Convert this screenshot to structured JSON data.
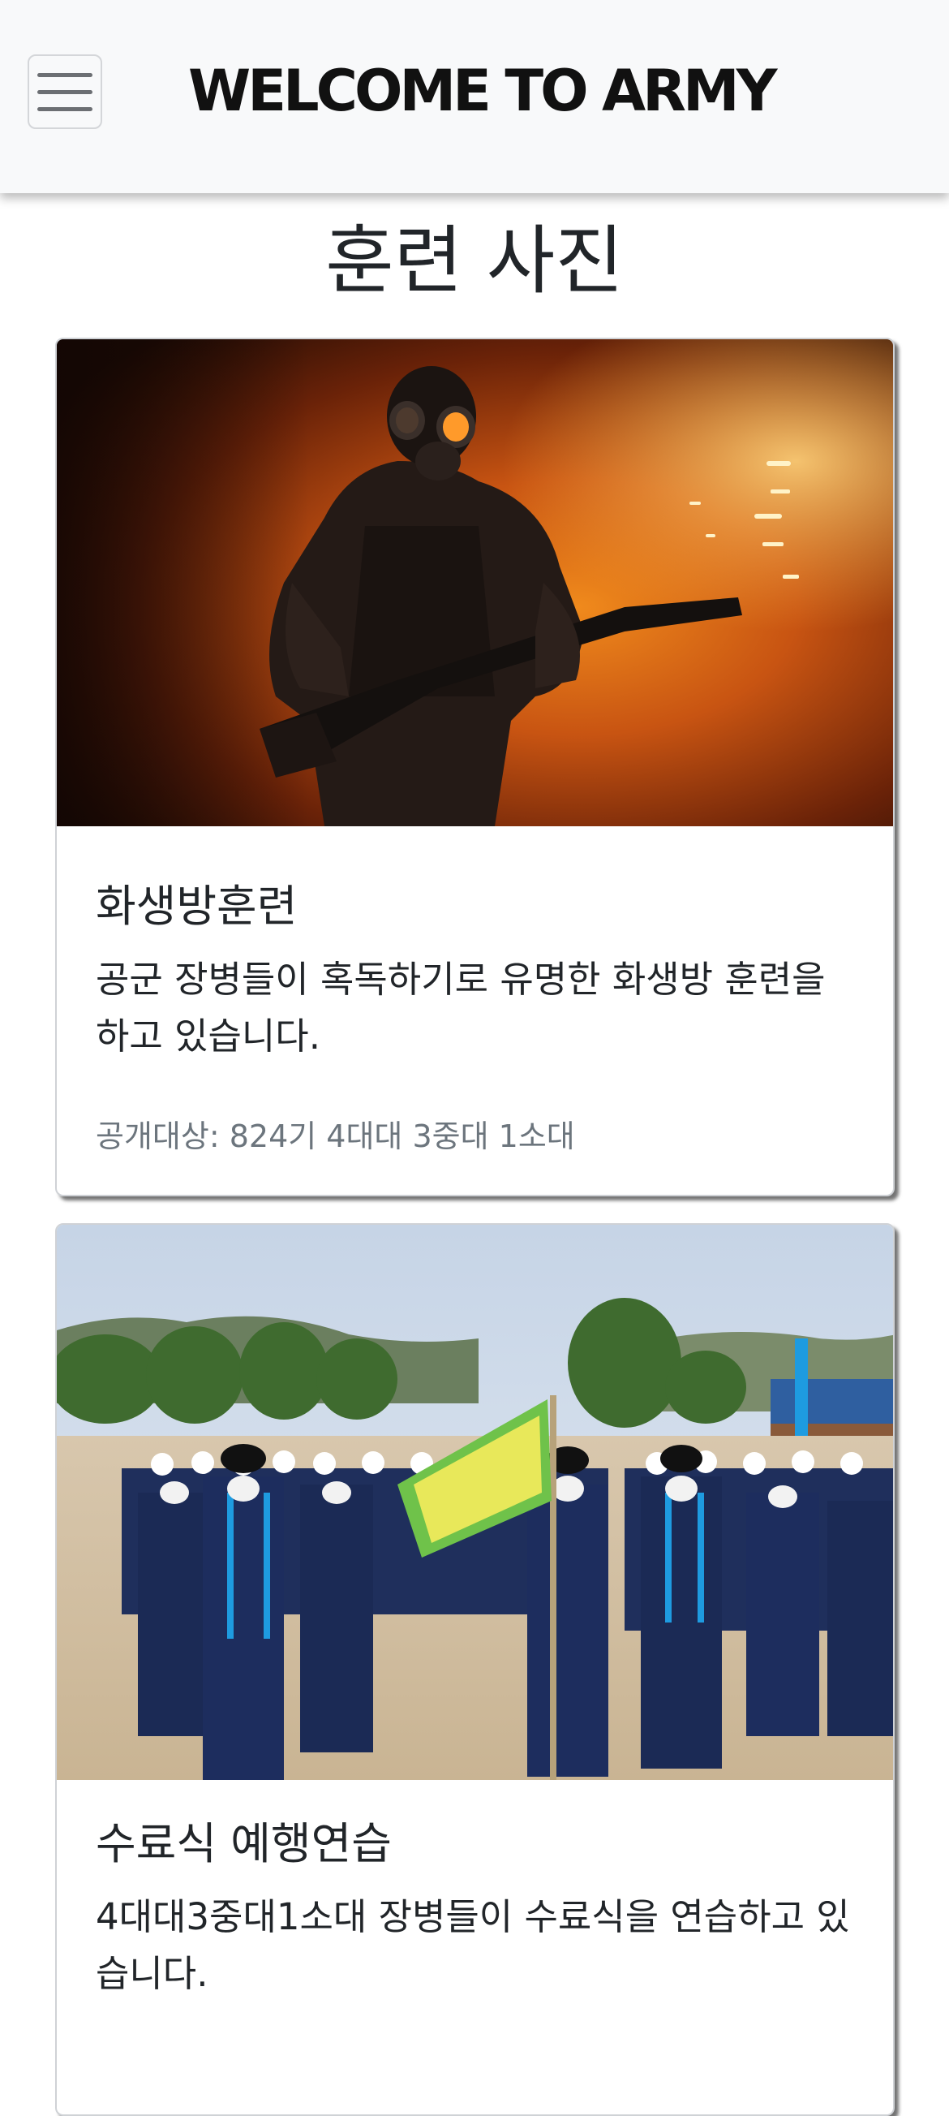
{
  "navbar": {
    "brand": "WELCOME TO ARMY",
    "menu_icon": "hamburger-menu-icon"
  },
  "page": {
    "title": "훈련 사진"
  },
  "cards": [
    {
      "title": "화생방훈련",
      "text": "공군 장병들이 혹독하기로 유명한 화생방 훈련을 하고 있습니다.",
      "footer": "공개대상: 824기 4대대 3중대 1소대",
      "image_desc": "soldier-gas-mask-photo"
    },
    {
      "title": "수료식 예행연습",
      "text": "4대대3중대1소대 장병들이 수료식을 연습하고 있습니다.",
      "image_desc": "recruits-formation-photo"
    }
  ],
  "colors": {
    "navbar_bg": "#f8f9fa",
    "muted_text": "#6c757d",
    "text": "#212529"
  }
}
